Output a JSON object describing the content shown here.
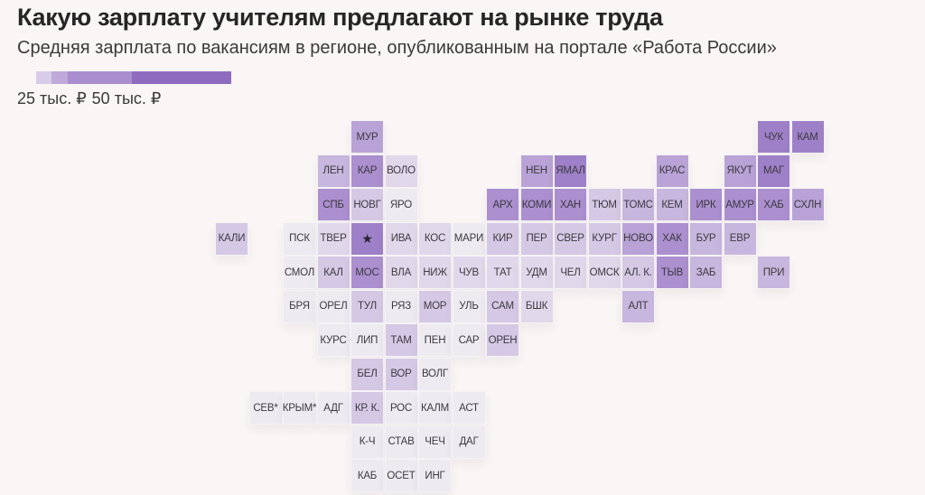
{
  "header": {
    "title": "Какую зарплату учителям предлагают на рынке труда",
    "subtitle": "Средняя зарплата по вакансиям в регионе, опубликованным на портале «Работа России»"
  },
  "legend": {
    "min_label": "25 тыс. ₽",
    "max_label": "50 тыс. ₽",
    "colors": [
      "#dcd0ea",
      "#c2aedd",
      "#a88bcf",
      "#8f6bbf"
    ],
    "steps": [
      {
        "color": "#d8cbe8",
        "share": 0.08
      },
      {
        "color": "#bea9da",
        "share": 0.08
      },
      {
        "color": "#a98dce",
        "share": 0.33
      },
      {
        "color": "#8f6bbf",
        "share": 0.51
      }
    ]
  },
  "palette": {
    "1": "#edeaf0",
    "2": "#e0d8ea",
    "3": "#d5c8e5",
    "4": "#c7b6dd",
    "5": "#b9a2d6",
    "6": "#ab8fcf",
    "7": "#9e80c8"
  },
  "chart_data": {
    "type": "heatmap",
    "title": "Какую зарплату учителям предлагают на рынке труда",
    "subtitle": "Средняя зарплата по вакансиям в регионе, опубликованным на портале «Работа России»",
    "color_scale": {
      "min_label": "25 тыс. ₽",
      "max_label": "50 тыс. ₽"
    },
    "note": "level = relative color intensity 1 (lightest) .. 7 (darkest)",
    "regions": [
      {
        "code": "МУР",
        "col": 4,
        "row": 0,
        "level": 5
      },
      {
        "code": "ЧУК",
        "col": 16,
        "row": 0,
        "level": 7
      },
      {
        "code": "КАМ",
        "col": 17,
        "row": 0,
        "level": 7
      },
      {
        "code": "ЛЕН",
        "col": 3,
        "row": 1,
        "level": 4
      },
      {
        "code": "КАР",
        "col": 4,
        "row": 1,
        "level": 6
      },
      {
        "code": "ВОЛО",
        "col": 5,
        "row": 1,
        "level": 2
      },
      {
        "code": "НЕН",
        "col": 9,
        "row": 1,
        "level": 5
      },
      {
        "code": "ЯМАЛ",
        "col": 10,
        "row": 1,
        "level": 7
      },
      {
        "code": "КРАС",
        "col": 13,
        "row": 1,
        "level": 5
      },
      {
        "code": "ЯКУТ",
        "col": 15,
        "row": 1,
        "level": 5
      },
      {
        "code": "МАГ",
        "col": 16,
        "row": 1,
        "level": 7
      },
      {
        "code": "СПБ",
        "col": 3,
        "row": 2,
        "level": 6
      },
      {
        "code": "НОВГ",
        "col": 4,
        "row": 2,
        "level": 3
      },
      {
        "code": "ЯРО",
        "col": 5,
        "row": 2,
        "level": 1
      },
      {
        "code": "АРХ",
        "col": 8,
        "row": 2,
        "level": 6
      },
      {
        "code": "КОМИ",
        "col": 9,
        "row": 2,
        "level": 6
      },
      {
        "code": "ХАН",
        "col": 10,
        "row": 2,
        "level": 6
      },
      {
        "code": "ТЮМ",
        "col": 11,
        "row": 2,
        "level": 3
      },
      {
        "code": "ТОМС",
        "col": 12,
        "row": 2,
        "level": 4
      },
      {
        "code": "КЕМ",
        "col": 13,
        "row": 2,
        "level": 4
      },
      {
        "code": "ИРК",
        "col": 14,
        "row": 2,
        "level": 6
      },
      {
        "code": "АМУР",
        "col": 15,
        "row": 2,
        "level": 6
      },
      {
        "code": "ХАБ",
        "col": 16,
        "row": 2,
        "level": 6
      },
      {
        "code": "СХЛН",
        "col": 17,
        "row": 2,
        "level": 5
      },
      {
        "code": "КАЛИ",
        "col": 0,
        "row": 3,
        "level": 3
      },
      {
        "code": "ПСК",
        "col": 2,
        "row": 3,
        "level": 1
      },
      {
        "code": "ТВЕР",
        "col": 3,
        "row": 3,
        "level": 2
      },
      {
        "code": "★",
        "col": 4,
        "row": 3,
        "level": 7
      },
      {
        "code": "ИВА",
        "col": 5,
        "row": 3,
        "level": 2
      },
      {
        "code": "КОС",
        "col": 6,
        "row": 3,
        "level": 2
      },
      {
        "code": "МАРИ",
        "col": 7,
        "row": 3,
        "level": 1
      },
      {
        "code": "КИР",
        "col": 8,
        "row": 3,
        "level": 3
      },
      {
        "code": "ПЕР",
        "col": 9,
        "row": 3,
        "level": 3
      },
      {
        "code": "СВЕР",
        "col": 10,
        "row": 3,
        "level": 3
      },
      {
        "code": "КУРГ",
        "col": 11,
        "row": 3,
        "level": 3
      },
      {
        "code": "НОВО",
        "col": 12,
        "row": 3,
        "level": 5
      },
      {
        "code": "ХАК",
        "col": 13,
        "row": 3,
        "level": 6
      },
      {
        "code": "БУР",
        "col": 14,
        "row": 3,
        "level": 4
      },
      {
        "code": "ЕВР",
        "col": 15,
        "row": 3,
        "level": 4
      },
      {
        "code": "СМОЛ",
        "col": 2,
        "row": 4,
        "level": 1
      },
      {
        "code": "КАЛ",
        "col": 3,
        "row": 4,
        "level": 3
      },
      {
        "code": "МОС",
        "col": 4,
        "row": 4,
        "level": 6
      },
      {
        "code": "ВЛА",
        "col": 5,
        "row": 4,
        "level": 2
      },
      {
        "code": "НИЖ",
        "col": 6,
        "row": 4,
        "level": 2
      },
      {
        "code": "ЧУВ",
        "col": 7,
        "row": 4,
        "level": 2
      },
      {
        "code": "ТАТ",
        "col": 8,
        "row": 4,
        "level": 2
      },
      {
        "code": "УДМ",
        "col": 9,
        "row": 4,
        "level": 2
      },
      {
        "code": "ЧЕЛ",
        "col": 10,
        "row": 4,
        "level": 2
      },
      {
        "code": "ОМСК",
        "col": 11,
        "row": 4,
        "level": 2
      },
      {
        "code": "АЛ. К.",
        "col": 12,
        "row": 4,
        "level": 3
      },
      {
        "code": "ТЫВ",
        "col": 13,
        "row": 4,
        "level": 6
      },
      {
        "code": "ЗАБ",
        "col": 14,
        "row": 4,
        "level": 4
      },
      {
        "code": "ПРИ",
        "col": 16,
        "row": 4,
        "level": 4
      },
      {
        "code": "БРЯ",
        "col": 2,
        "row": 5,
        "level": 1
      },
      {
        "code": "ОРЕЛ",
        "col": 3,
        "row": 5,
        "level": 1
      },
      {
        "code": "ТУЛ",
        "col": 4,
        "row": 5,
        "level": 3
      },
      {
        "code": "РЯЗ",
        "col": 5,
        "row": 5,
        "level": 1
      },
      {
        "code": "МОР",
        "col": 6,
        "row": 5,
        "level": 3
      },
      {
        "code": "УЛЬ",
        "col": 7,
        "row": 5,
        "level": 1
      },
      {
        "code": "САМ",
        "col": 8,
        "row": 5,
        "level": 3
      },
      {
        "code": "БШК",
        "col": 9,
        "row": 5,
        "level": 2
      },
      {
        "code": "АЛТ",
        "col": 12,
        "row": 5,
        "level": 4
      },
      {
        "code": "КУРС",
        "col": 3,
        "row": 6,
        "level": 1
      },
      {
        "code": "ЛИП",
        "col": 4,
        "row": 6,
        "level": 1
      },
      {
        "code": "ТАМ",
        "col": 5,
        "row": 6,
        "level": 3
      },
      {
        "code": "ПЕН",
        "col": 6,
        "row": 6,
        "level": 1
      },
      {
        "code": "САР",
        "col": 7,
        "row": 6,
        "level": 1
      },
      {
        "code": "ОРЕН",
        "col": 8,
        "row": 6,
        "level": 3
      },
      {
        "code": "БЕЛ",
        "col": 4,
        "row": 7,
        "level": 3
      },
      {
        "code": "ВОР",
        "col": 5,
        "row": 7,
        "level": 3
      },
      {
        "code": "ВОЛГ",
        "col": 6,
        "row": 7,
        "level": 1
      },
      {
        "code": "СЕВ*",
        "col": 1,
        "row": 8,
        "level": 1
      },
      {
        "code": "КРЫМ*",
        "col": 2,
        "row": 8,
        "level": 1
      },
      {
        "code": "АДГ",
        "col": 3,
        "row": 8,
        "level": 1
      },
      {
        "code": "КР. К.",
        "col": 4,
        "row": 8,
        "level": 3
      },
      {
        "code": "РОС",
        "col": 5,
        "row": 8,
        "level": 1
      },
      {
        "code": "КАЛМ",
        "col": 6,
        "row": 8,
        "level": 1
      },
      {
        "code": "АСТ",
        "col": 7,
        "row": 8,
        "level": 1
      },
      {
        "code": "К-Ч",
        "col": 4,
        "row": 9,
        "level": 1
      },
      {
        "code": "СТАВ",
        "col": 5,
        "row": 9,
        "level": 1
      },
      {
        "code": "ЧЕЧ",
        "col": 6,
        "row": 9,
        "level": 1
      },
      {
        "code": "ДАГ",
        "col": 7,
        "row": 9,
        "level": 1
      },
      {
        "code": "КАБ",
        "col": 4,
        "row": 10,
        "level": 1
      },
      {
        "code": "ОСЕТ",
        "col": 5,
        "row": 10,
        "level": 1
      },
      {
        "code": "ИНГ",
        "col": 6,
        "row": 10,
        "level": 1
      }
    ]
  }
}
